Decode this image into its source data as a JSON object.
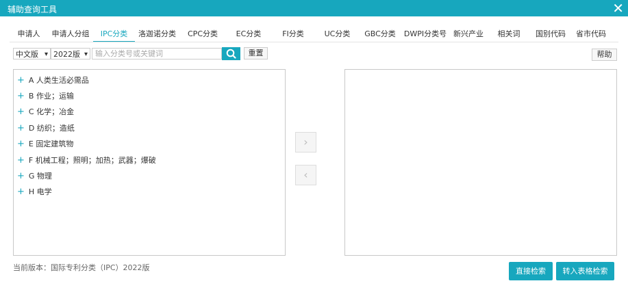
{
  "window": {
    "title": "辅助查询工具",
    "close_symbol": "✕"
  },
  "tabs": [
    {
      "label": "申请人"
    },
    {
      "label": "申请人分组"
    },
    {
      "label": "IPC分类",
      "active": true
    },
    {
      "label": "洛迦诺分类"
    },
    {
      "label": "CPC分类"
    },
    {
      "label": "EC分类"
    },
    {
      "label": "FI分类"
    },
    {
      "label": "UC分类"
    },
    {
      "label": "GBC分类"
    },
    {
      "label": "DWPI分类号"
    },
    {
      "label": "新兴产业"
    },
    {
      "label": "相关词"
    },
    {
      "label": "国别代码"
    },
    {
      "label": "省市代码"
    }
  ],
  "toolbar": {
    "language_select": "中文版",
    "version_select": "2022版",
    "search_placeholder": "输入分类号或关键词",
    "reset_label": "重置",
    "help_label": "帮助"
  },
  "tree": [
    {
      "label": "A 人类生活必需品"
    },
    {
      "label": "B 作业；运输"
    },
    {
      "label": "C 化学；冶金"
    },
    {
      "label": "D 纺织；造纸"
    },
    {
      "label": "E 固定建筑物"
    },
    {
      "label": "F 机械工程；照明；加热；武器；爆破"
    },
    {
      "label": "G 物理"
    },
    {
      "label": "H 电学"
    }
  ],
  "transfer": {
    "add_symbol": "›",
    "remove_symbol": "‹"
  },
  "footer": {
    "version_text": "当前版本：国际专利分类（IPC）2022版",
    "direct_search_label": "直接检索",
    "table_search_label": "转入表格检索"
  },
  "colors": {
    "accent": "#17a7be"
  }
}
